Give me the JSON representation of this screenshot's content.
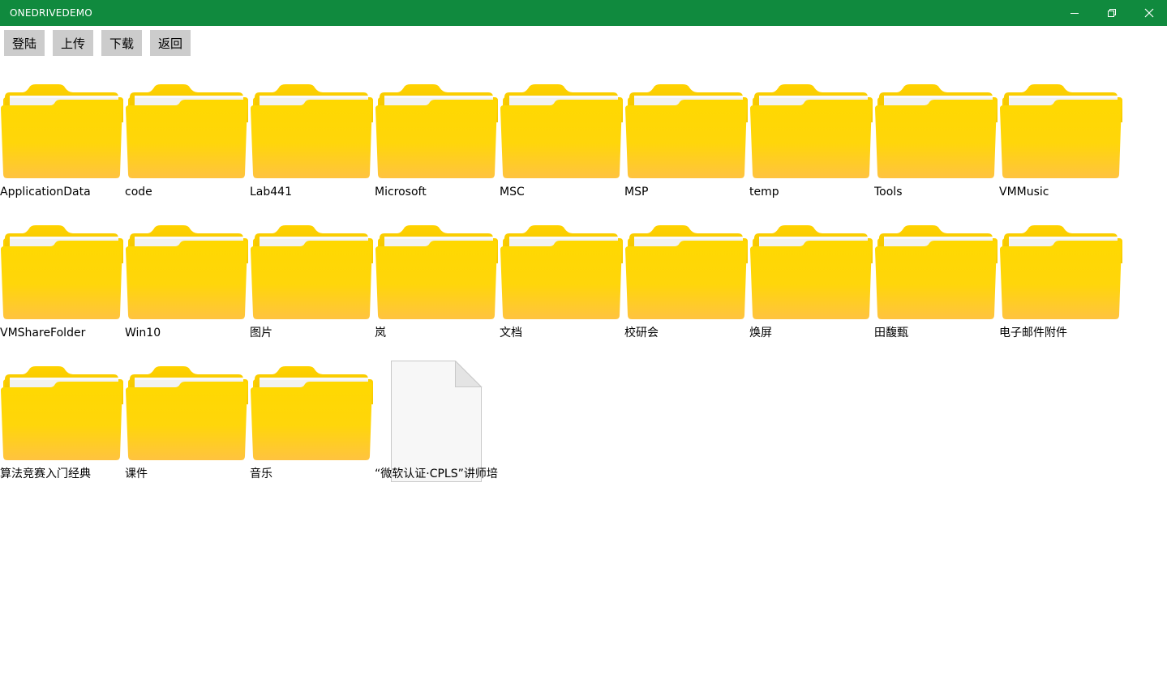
{
  "window": {
    "title": "ONEDRIVEDEMO",
    "controls": [
      {
        "name": "minimize",
        "icon": "minimize-icon"
      },
      {
        "name": "restore",
        "icon": "restore-icon"
      },
      {
        "name": "close",
        "icon": "close-icon"
      }
    ],
    "titlebar_color": "#108a3e"
  },
  "toolbar": {
    "login_label": "登陆",
    "upload_label": "上传",
    "download_label": "下载",
    "back_label": "返回"
  },
  "items": [
    {
      "name": "ApplicationData",
      "type": "folder"
    },
    {
      "name": "code",
      "type": "folder"
    },
    {
      "name": "Lab441",
      "type": "folder"
    },
    {
      "name": "Microsoft",
      "type": "folder"
    },
    {
      "name": "MSC",
      "type": "folder"
    },
    {
      "name": "MSP",
      "type": "folder"
    },
    {
      "name": "temp",
      "type": "folder"
    },
    {
      "name": "Tools",
      "type": "folder"
    },
    {
      "name": "VMMusic",
      "type": "folder"
    },
    {
      "name": "VMShareFolder",
      "type": "folder"
    },
    {
      "name": "Win10",
      "type": "folder"
    },
    {
      "name": "图片",
      "type": "folder"
    },
    {
      "name": "岚",
      "type": "folder"
    },
    {
      "name": "文档",
      "type": "folder"
    },
    {
      "name": "校研会",
      "type": "folder"
    },
    {
      "name": "焕屏",
      "type": "folder"
    },
    {
      "name": "田馥甄",
      "type": "folder"
    },
    {
      "name": "电子邮件附件",
      "type": "folder"
    },
    {
      "name": "算法竞赛入门经典",
      "type": "folder"
    },
    {
      "name": "课件",
      "type": "folder"
    },
    {
      "name": "音乐",
      "type": "folder"
    },
    {
      "name": "“微软认证·CPLS”讲师培",
      "type": "file"
    }
  ],
  "icons": {
    "folder": "folder-icon",
    "file": "file-icon"
  }
}
